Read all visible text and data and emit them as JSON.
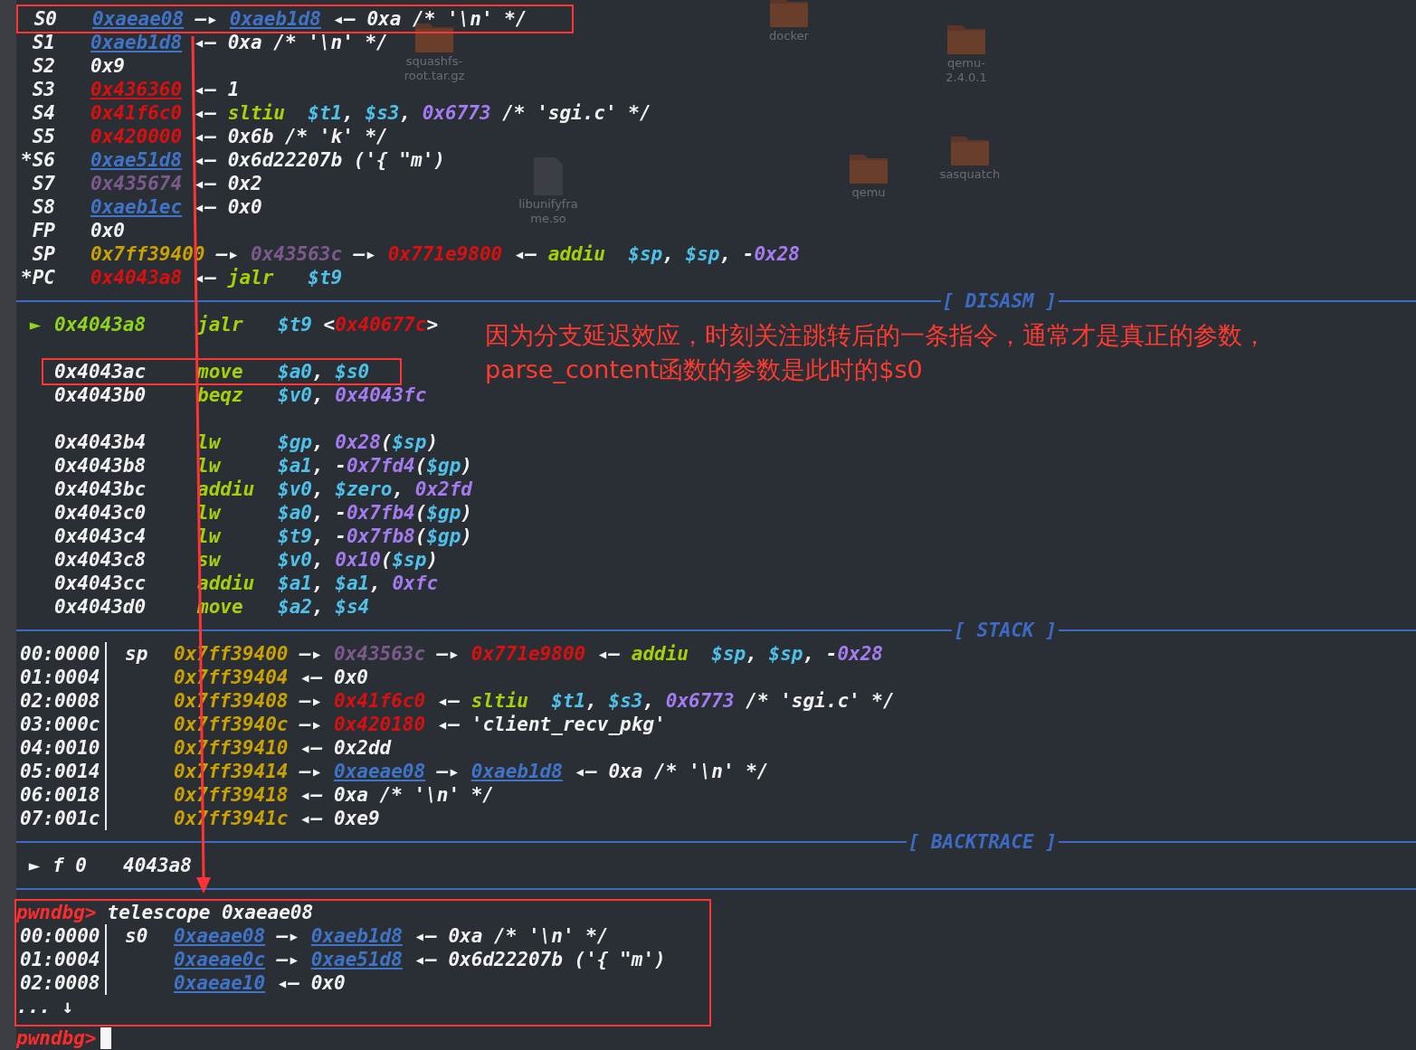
{
  "desktop_icons": [
    {
      "label": "docker"
    },
    {
      "label": "qemu-\n2.4.0.1"
    },
    {
      "label": "squashfs-\nroot.tar.gz"
    },
    {
      "label": "sasquatch"
    },
    {
      "label": "qemu"
    },
    {
      "label": "libunifyfra\nme.so"
    }
  ],
  "registers": [
    {
      "name": "S0",
      "highlighted": true,
      "tokens": [
        {
          "text": "0xaeae08",
          "kind": "heap"
        },
        {
          "text": " —▸ ",
          "kind": "plain"
        },
        {
          "text": "0xaeb1d8",
          "kind": "heap"
        },
        {
          "text": " ◂— 0xa /* '\\n' */",
          "kind": "plain"
        }
      ]
    },
    {
      "name": "S1",
      "highlighted": false,
      "tokens": [
        {
          "text": "0xaeb1d8",
          "kind": "heap"
        },
        {
          "text": " ◂— 0xa /* '\\n' */",
          "kind": "plain"
        }
      ]
    },
    {
      "name": "S2",
      "highlighted": false,
      "tokens": [
        {
          "text": "0x9",
          "kind": "plain"
        }
      ]
    },
    {
      "name": "S3",
      "highlighted": false,
      "tokens": [
        {
          "text": "0x436360",
          "kind": "code_ul"
        },
        {
          "text": " ◂— 1",
          "kind": "plain"
        }
      ]
    },
    {
      "name": "S4",
      "highlighted": false,
      "tokens": [
        {
          "text": "0x41f6c0",
          "kind": "code"
        },
        {
          "text": " ◂— ",
          "kind": "plain"
        },
        {
          "text": "sltiu  ",
          "kind": "op"
        },
        {
          "text": "$t1",
          "kind": "reg"
        },
        {
          "text": ", ",
          "kind": "plain"
        },
        {
          "text": "$s3",
          "kind": "reg"
        },
        {
          "text": ", ",
          "kind": "plain"
        },
        {
          "text": "0x6773",
          "kind": "num"
        },
        {
          "text": " /* 'sgi.c' */",
          "kind": "plain"
        }
      ]
    },
    {
      "name": "S5",
      "highlighted": false,
      "tokens": [
        {
          "text": "0x420000",
          "kind": "code"
        },
        {
          "text": " ◂— 0x6b /* 'k' */",
          "kind": "plain"
        }
      ]
    },
    {
      "name": "*S6",
      "highlighted": false,
      "tokens": [
        {
          "text": "0xae51d8",
          "kind": "heap"
        },
        {
          "text": " ◂— 0x6d22207b ('{ \"m')",
          "kind": "plain"
        }
      ]
    },
    {
      "name": "S7",
      "highlighted": false,
      "tokens": [
        {
          "text": "0x435674",
          "kind": "rodata"
        },
        {
          "text": " ◂— 0x2",
          "kind": "plain"
        }
      ]
    },
    {
      "name": "S8",
      "highlighted": false,
      "tokens": [
        {
          "text": "0xaeb1ec",
          "kind": "heap"
        },
        {
          "text": " ◂— 0x0",
          "kind": "plain"
        }
      ]
    },
    {
      "name": "FP",
      "highlighted": false,
      "tokens": [
        {
          "text": "0x0",
          "kind": "plain"
        }
      ]
    },
    {
      "name": "SP",
      "highlighted": false,
      "tokens": [
        {
          "text": "0x7ff39400",
          "kind": "stack"
        },
        {
          "text": " —▸ ",
          "kind": "plain"
        },
        {
          "text": "0x43563c",
          "kind": "rodata"
        },
        {
          "text": " —▸ ",
          "kind": "plain"
        },
        {
          "text": "0x771e9800",
          "kind": "code"
        },
        {
          "text": " ◂— ",
          "kind": "plain"
        },
        {
          "text": "addiu  ",
          "kind": "op"
        },
        {
          "text": "$sp",
          "kind": "reg"
        },
        {
          "text": ", ",
          "kind": "plain"
        },
        {
          "text": "$sp",
          "kind": "reg"
        },
        {
          "text": ", -",
          "kind": "plain"
        },
        {
          "text": "0x28",
          "kind": "num"
        }
      ]
    },
    {
      "name": "*PC",
      "highlighted": false,
      "tokens": [
        {
          "text": "0x4043a8",
          "kind": "code"
        },
        {
          "text": " ◂— ",
          "kind": "plain"
        },
        {
          "text": "jalr   ",
          "kind": "op"
        },
        {
          "text": "$t9",
          "kind": "reg"
        }
      ]
    }
  ],
  "disasm": {
    "title": "[ DISASM ]",
    "lines": [
      {
        "current": true,
        "marker": "►",
        "address": "0x4043a8",
        "mnemonic": "jalr",
        "highlighted": false,
        "gap_after": true,
        "operands": [
          {
            "text": "$t9",
            "kind": "reg"
          },
          {
            "text": " <",
            "kind": "plain"
          },
          {
            "text": "0x40677c",
            "kind": "code"
          },
          {
            "text": ">",
            "kind": "plain"
          }
        ]
      },
      {
        "current": false,
        "address": "0x4043ac",
        "mnemonic": "move",
        "highlighted": true,
        "gap_after": false,
        "operands": [
          {
            "text": "$a0",
            "kind": "reg"
          },
          {
            "text": ", ",
            "kind": "plain"
          },
          {
            "text": "$s0",
            "kind": "reg"
          }
        ]
      },
      {
        "current": false,
        "address": "0x4043b0",
        "mnemonic": "beqz",
        "highlighted": false,
        "gap_after": true,
        "operands": [
          {
            "text": "$v0",
            "kind": "reg"
          },
          {
            "text": ", ",
            "kind": "plain"
          },
          {
            "text": "0x4043fc",
            "kind": "num"
          }
        ]
      },
      {
        "current": false,
        "address": "0x4043b4",
        "mnemonic": "lw",
        "highlighted": false,
        "gap_after": false,
        "operands": [
          {
            "text": "$gp",
            "kind": "reg"
          },
          {
            "text": ", ",
            "kind": "plain"
          },
          {
            "text": "0x28",
            "kind": "num"
          },
          {
            "text": "(",
            "kind": "plain"
          },
          {
            "text": "$sp",
            "kind": "reg"
          },
          {
            "text": ")",
            "kind": "plain"
          }
        ]
      },
      {
        "current": false,
        "address": "0x4043b8",
        "mnemonic": "lw",
        "highlighted": false,
        "gap_after": false,
        "operands": [
          {
            "text": "$a1",
            "kind": "reg"
          },
          {
            "text": ", -",
            "kind": "plain"
          },
          {
            "text": "0x7fd4",
            "kind": "num"
          },
          {
            "text": "(",
            "kind": "plain"
          },
          {
            "text": "$gp",
            "kind": "reg"
          },
          {
            "text": ")",
            "kind": "plain"
          }
        ]
      },
      {
        "current": false,
        "address": "0x4043bc",
        "mnemonic": "addiu",
        "highlighted": false,
        "gap_after": false,
        "operands": [
          {
            "text": "$v0",
            "kind": "reg"
          },
          {
            "text": ", ",
            "kind": "plain"
          },
          {
            "text": "$zero",
            "kind": "reg"
          },
          {
            "text": ", ",
            "kind": "plain"
          },
          {
            "text": "0x2fd",
            "kind": "num"
          }
        ]
      },
      {
        "current": false,
        "address": "0x4043c0",
        "mnemonic": "lw",
        "highlighted": false,
        "gap_after": false,
        "operands": [
          {
            "text": "$a0",
            "kind": "reg"
          },
          {
            "text": ", -",
            "kind": "plain"
          },
          {
            "text": "0x7fb4",
            "kind": "num"
          },
          {
            "text": "(",
            "kind": "plain"
          },
          {
            "text": "$gp",
            "kind": "reg"
          },
          {
            "text": ")",
            "kind": "plain"
          }
        ]
      },
      {
        "current": false,
        "address": "0x4043c4",
        "mnemonic": "lw",
        "highlighted": false,
        "gap_after": false,
        "operands": [
          {
            "text": "$t9",
            "kind": "reg"
          },
          {
            "text": ", -",
            "kind": "plain"
          },
          {
            "text": "0x7fb8",
            "kind": "num"
          },
          {
            "text": "(",
            "kind": "plain"
          },
          {
            "text": "$gp",
            "kind": "reg"
          },
          {
            "text": ")",
            "kind": "plain"
          }
        ]
      },
      {
        "current": false,
        "address": "0x4043c8",
        "mnemonic": "sw",
        "highlighted": false,
        "gap_after": false,
        "operands": [
          {
            "text": "$v0",
            "kind": "reg"
          },
          {
            "text": ", ",
            "kind": "plain"
          },
          {
            "text": "0x10",
            "kind": "num"
          },
          {
            "text": "(",
            "kind": "plain"
          },
          {
            "text": "$sp",
            "kind": "reg"
          },
          {
            "text": ")",
            "kind": "plain"
          }
        ]
      },
      {
        "current": false,
        "address": "0x4043cc",
        "mnemonic": "addiu",
        "highlighted": false,
        "gap_after": false,
        "operands": [
          {
            "text": "$a1",
            "kind": "reg"
          },
          {
            "text": ", ",
            "kind": "plain"
          },
          {
            "text": "$a1",
            "kind": "reg"
          },
          {
            "text": ", ",
            "kind": "plain"
          },
          {
            "text": "0xfc",
            "kind": "num"
          }
        ]
      },
      {
        "current": false,
        "address": "0x4043d0",
        "mnemonic": "move",
        "highlighted": false,
        "gap_after": false,
        "operands": [
          {
            "text": "$a2",
            "kind": "reg"
          },
          {
            "text": ", ",
            "kind": "plain"
          },
          {
            "text": "$s4",
            "kind": "reg"
          }
        ]
      }
    ]
  },
  "annotation": [
    "因为分支延迟效应，时刻关注跳转后的一条指令，通常才是真正的参数，",
    "parse_content函数的参数是此时的$s0"
  ],
  "stack": {
    "title": "[ STACK ]",
    "rows": [
      {
        "offset": "00:0000",
        "label": "sp",
        "tokens": [
          {
            "text": "0x7ff39400",
            "kind": "stack"
          },
          {
            "text": " —▸ ",
            "kind": "plain"
          },
          {
            "text": "0x43563c",
            "kind": "rodata"
          },
          {
            "text": " —▸ ",
            "kind": "plain"
          },
          {
            "text": "0x771e9800",
            "kind": "code"
          },
          {
            "text": " ◂— ",
            "kind": "plain"
          },
          {
            "text": "addiu  ",
            "kind": "op"
          },
          {
            "text": "$sp",
            "kind": "reg"
          },
          {
            "text": ", ",
            "kind": "plain"
          },
          {
            "text": "$sp",
            "kind": "reg"
          },
          {
            "text": ", -",
            "kind": "plain"
          },
          {
            "text": "0x28",
            "kind": "num"
          }
        ]
      },
      {
        "offset": "01:0004",
        "tokens": [
          {
            "text": "0x7ff39404",
            "kind": "stack"
          },
          {
            "text": " ◂— 0x0",
            "kind": "plain"
          }
        ]
      },
      {
        "offset": "02:0008",
        "tokens": [
          {
            "text": "0x7ff39408",
            "kind": "stack"
          },
          {
            "text": " —▸ ",
            "kind": "plain"
          },
          {
            "text": "0x41f6c0",
            "kind": "code"
          },
          {
            "text": " ◂— ",
            "kind": "plain"
          },
          {
            "text": "sltiu  ",
            "kind": "op"
          },
          {
            "text": "$t1",
            "kind": "reg"
          },
          {
            "text": ", ",
            "kind": "plain"
          },
          {
            "text": "$s3",
            "kind": "reg"
          },
          {
            "text": ", ",
            "kind": "plain"
          },
          {
            "text": "0x6773",
            "kind": "num"
          },
          {
            "text": " /* 'sgi.c' */",
            "kind": "plain"
          }
        ]
      },
      {
        "offset": "03:000c",
        "tokens": [
          {
            "text": "0x7ff3940c",
            "kind": "stack"
          },
          {
            "text": " —▸ ",
            "kind": "plain"
          },
          {
            "text": "0x420180",
            "kind": "code"
          },
          {
            "text": " ◂— 'client_recv_pkg'",
            "kind": "plain"
          }
        ]
      },
      {
        "offset": "04:0010",
        "tokens": [
          {
            "text": "0x7ff39410",
            "kind": "stack"
          },
          {
            "text": " ◂— 0x2dd",
            "kind": "plain"
          }
        ]
      },
      {
        "offset": "05:0014",
        "tokens": [
          {
            "text": "0x7ff39414",
            "kind": "stack"
          },
          {
            "text": " —▸ ",
            "kind": "plain"
          },
          {
            "text": "0xaeae08",
            "kind": "heap"
          },
          {
            "text": " —▸ ",
            "kind": "plain"
          },
          {
            "text": "0xaeb1d8",
            "kind": "heap"
          },
          {
            "text": " ◂— 0xa /* '\\n' */",
            "kind": "plain"
          }
        ]
      },
      {
        "offset": "06:0018",
        "tokens": [
          {
            "text": "0x7ff39418",
            "kind": "stack"
          },
          {
            "text": " ◂— 0xa /* '\\n' */",
            "kind": "plain"
          }
        ]
      },
      {
        "offset": "07:001c",
        "tokens": [
          {
            "text": "0x7ff3941c",
            "kind": "stack"
          },
          {
            "text": " ◂— 0xe9",
            "kind": "plain"
          }
        ]
      }
    ]
  },
  "backtrace": {
    "title": "[ BACKTRACE ]",
    "frames": [
      {
        "marker": "►",
        "frame": "f 0",
        "address": "4043a8"
      }
    ]
  },
  "console": {
    "prompt": "pwndbg>",
    "command": "telescope 0xaeae08",
    "rows": [
      {
        "offset": "00:0000",
        "label": "s0",
        "tokens": [
          {
            "text": "0xaeae08",
            "kind": "heap"
          },
          {
            "text": " —▸ ",
            "kind": "plain"
          },
          {
            "text": "0xaeb1d8",
            "kind": "heap"
          },
          {
            "text": " ◂— 0xa /* '\\n' */",
            "kind": "plain"
          }
        ]
      },
      {
        "offset": "01:0004",
        "tokens": [
          {
            "text": "0xaeae0c",
            "kind": "heap"
          },
          {
            "text": " —▸ ",
            "kind": "plain"
          },
          {
            "text": "0xae51d8",
            "kind": "heap"
          },
          {
            "text": " ◂— 0x6d22207b ('{ \"m')",
            "kind": "plain"
          }
        ]
      },
      {
        "offset": "02:0008",
        "tokens": [
          {
            "text": "0xaeae10",
            "kind": "heap"
          },
          {
            "text": " ◂— 0x0",
            "kind": "plain"
          }
        ]
      }
    ],
    "more": "... ↓",
    "highlighted": true,
    "final_prompt": "pwndbg>"
  }
}
